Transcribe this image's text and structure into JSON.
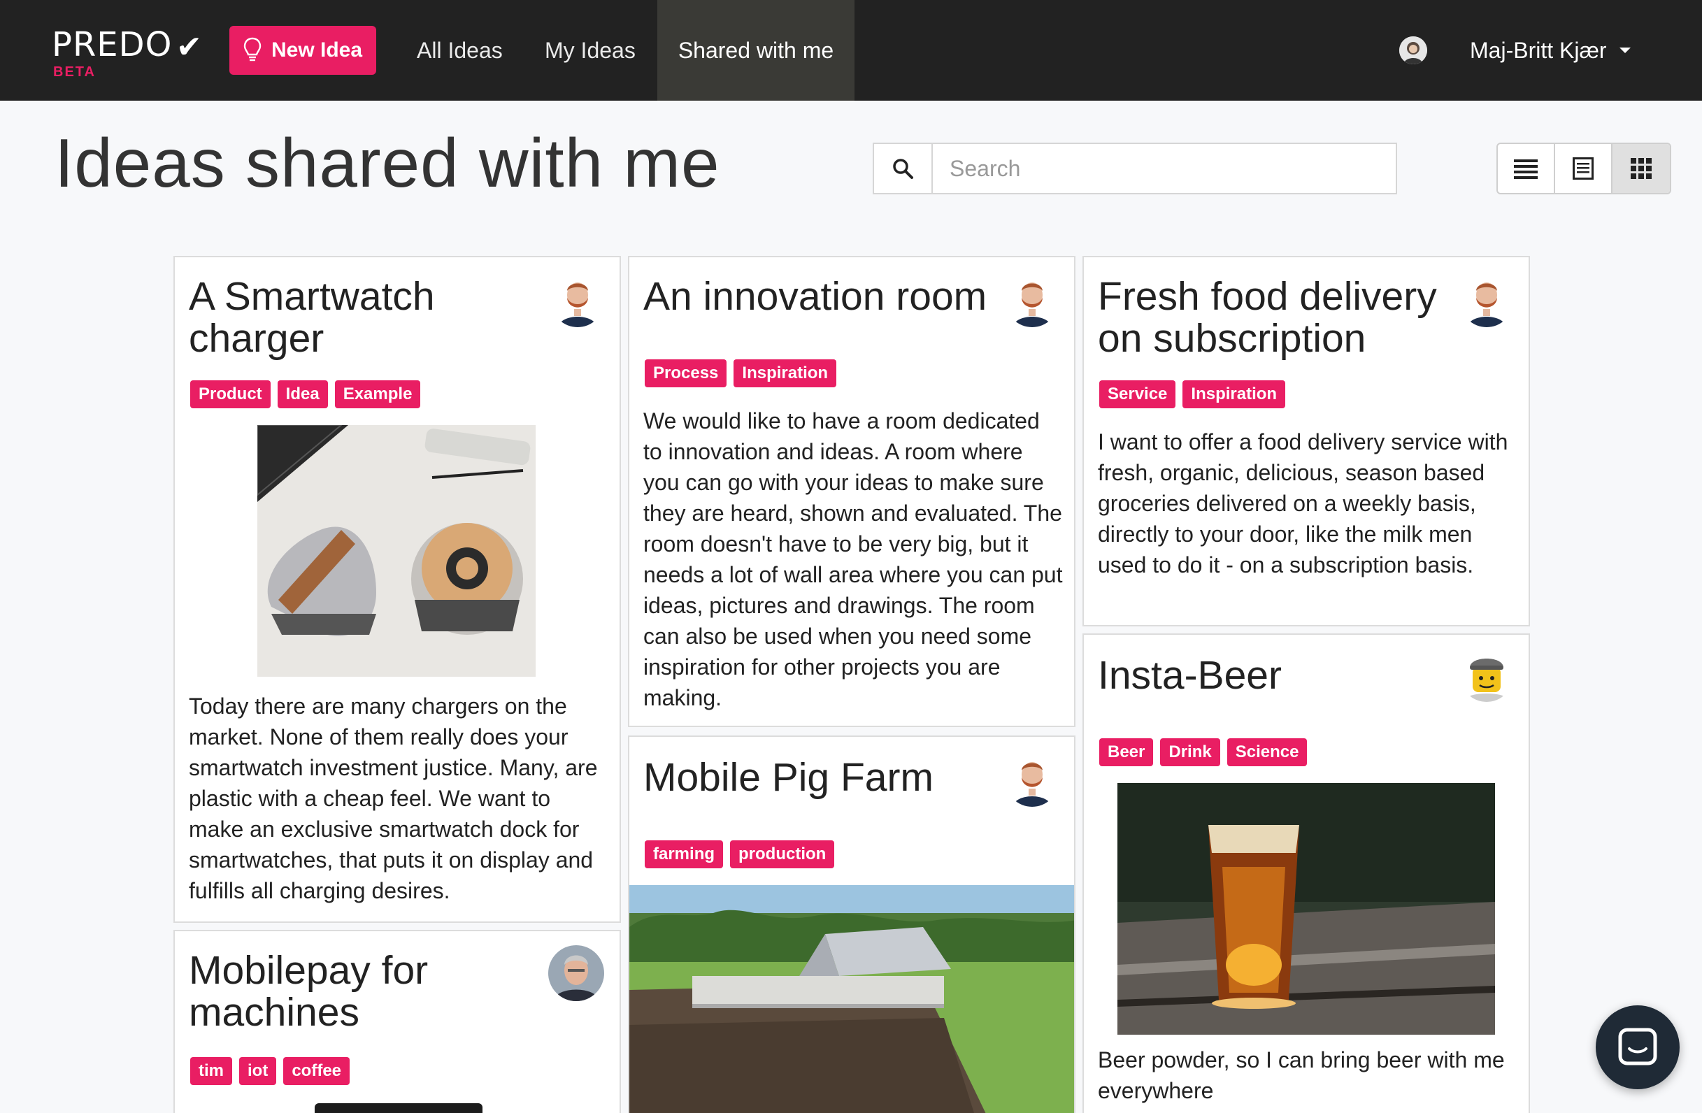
{
  "app": {
    "logo_text": "PREDO",
    "logo_badge": "BETA",
    "new_idea_label": "New Idea"
  },
  "nav": {
    "all_ideas": "All Ideas",
    "my_ideas": "My Ideas",
    "shared_with_me": "Shared with me",
    "active": "shared_with_me"
  },
  "user": {
    "name": "Maj-Britt Kjær"
  },
  "page": {
    "title": "Ideas shared with me"
  },
  "search": {
    "placeholder": "Search"
  },
  "view_modes": [
    "list",
    "detail",
    "grid"
  ],
  "active_view": "grid",
  "colors": {
    "accent": "#e91e63",
    "navbar": "#222222"
  },
  "ideas": [
    {
      "title": "A Smartwatch charger",
      "tags": [
        "Product",
        "Idea",
        "Example"
      ],
      "text": "Today there are many chargers on the market. None of them really does your smartwatch investment justice. Many, are plastic with a cheap feel. We want to make an exclusive smartwatch dock for smartwatches, that puts it on display and fulfills all charging desires.",
      "author_avatar": "bearded-man-avatar",
      "image": "sketch-image"
    },
    {
      "title": "An innovation room",
      "tags": [
        "Process",
        "Inspiration"
      ],
      "text": "We would like to have a room dedicated to innovation and ideas. A room where you can go with your ideas to make sure they are heard, shown and evaluated. The room doesn't have to be very big, but it needs a lot of wall area where you can put ideas, pictures and drawings. The room can also be used when you need some inspiration for other projects you are making.",
      "author_avatar": "bearded-man-avatar"
    },
    {
      "title": "Fresh food delivery on subscription",
      "tags": [
        "Service",
        "Inspiration"
      ],
      "text": "I want to offer a food delivery service with fresh, organic, delicious, season based groceries delivered on a weekly basis, directly to your door, like the milk men used to do it - on a subscription basis.",
      "author_avatar": "bearded-man-avatar"
    },
    {
      "title": "Mobilepay for machines",
      "tags": [
        "tim",
        "iot",
        "coffee"
      ],
      "author_avatar": "older-man-avatar"
    },
    {
      "title": "Mobile Pig Farm",
      "tags": [
        "farming",
        "production"
      ],
      "author_avatar": "bearded-man-avatar",
      "image": "farm-image"
    },
    {
      "title": "Insta-Beer",
      "tags": [
        "Beer",
        "Drink",
        "Science"
      ],
      "text": "Beer powder, so I can bring beer with me everywhere",
      "author_avatar": "lego-avatar",
      "image": "beer-image"
    }
  ]
}
